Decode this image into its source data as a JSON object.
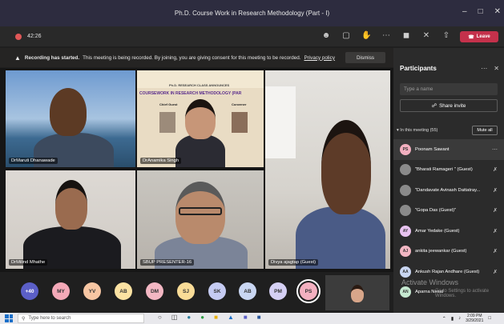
{
  "window": {
    "title": "Ph.D. Course Work in Research Methodology (Part - I)"
  },
  "toolbar": {
    "timer": "42:26",
    "leave_label": "Leave",
    "icons": [
      "participants-icon",
      "chat-icon",
      "raise-hand-icon",
      "more-icon",
      "camera-off-icon",
      "mic-off-icon",
      "share-icon"
    ]
  },
  "banner": {
    "bold": "Recording has started.",
    "text": "This meeting is being recorded. By joining, you are giving consent for this meeting to be recorded.",
    "link": "Privacy policy",
    "dismiss": "Dismiss"
  },
  "tiles": [
    {
      "name": "DrMaruti Dhanawade"
    },
    {
      "name": "DrAnamika Singh"
    },
    {
      "name": "DrMilind Mhathe"
    },
    {
      "name": "SBUP PRESENTER-16"
    },
    {
      "name": "Divya ajagtap (Guest)"
    }
  ],
  "poster": {
    "line1": "Ph.D. RESEARCH CLASS ANNOUNCES",
    "line2": "COURSEWORK IN RESEARCH METHODOLOGY (PAR",
    "line3": "Chief Guest",
    "line4": "Convener"
  },
  "avatars": [
    {
      "initials": "+40",
      "color": "#5b5fc7"
    },
    {
      "initials": "MY",
      "color": "#f4a9b8"
    },
    {
      "initials": "YV",
      "color": "#f7c6a3"
    },
    {
      "initials": "AB",
      "color": "#fbe2a2"
    },
    {
      "initials": "DM",
      "color": "#f3b7c3"
    },
    {
      "initials": "SJ",
      "color": "#f9dc97"
    },
    {
      "initials": "SK",
      "color": "#c5cbf2"
    },
    {
      "initials": "AB",
      "color": "#c9d6f2"
    },
    {
      "initials": "PM",
      "color": "#d5d0f4"
    },
    {
      "initials": "PS",
      "color": "#f3b0c0"
    }
  ],
  "participants": {
    "title": "Participants",
    "search_placeholder": "Type a name",
    "share_invite": "Share invite",
    "in_meeting": "In this meeting (55)",
    "mute_all": "Mute all",
    "list": [
      {
        "name": "Poonam Sawant",
        "initials": "PS",
        "color": "#f3b0c0"
      },
      {
        "name": "\"Bharati Ramageri \" (Guest)",
        "initials": "",
        "color": "#8a8a8a"
      },
      {
        "name": "\"Dandavate Avinash Dattatray...",
        "initials": "",
        "color": "#8a8a8a"
      },
      {
        "name": "\"Gopa Das (Guest)\"",
        "initials": "",
        "color": "#8a8a8a"
      },
      {
        "name": "Amar Yedake (Guest)",
        "initials": "AY",
        "color": "#e8c3f0"
      },
      {
        "name": "ankita jeewankar (Guest)",
        "initials": "AJ",
        "color": "#f3b7c3"
      },
      {
        "name": "Ankush Rajan Andhare (Guest)",
        "initials": "AA",
        "color": "#c9d6f2"
      },
      {
        "name": "Aparna Nesal",
        "initials": "AN",
        "color": "#c5e8d0"
      }
    ]
  },
  "watermark": {
    "line1": "Activate Windows",
    "line2": "Go to Settings to activate Windows."
  },
  "taskbar": {
    "search_placeholder": "Type here to search",
    "time": "2:09 PM",
    "date": "3/29/2021"
  }
}
